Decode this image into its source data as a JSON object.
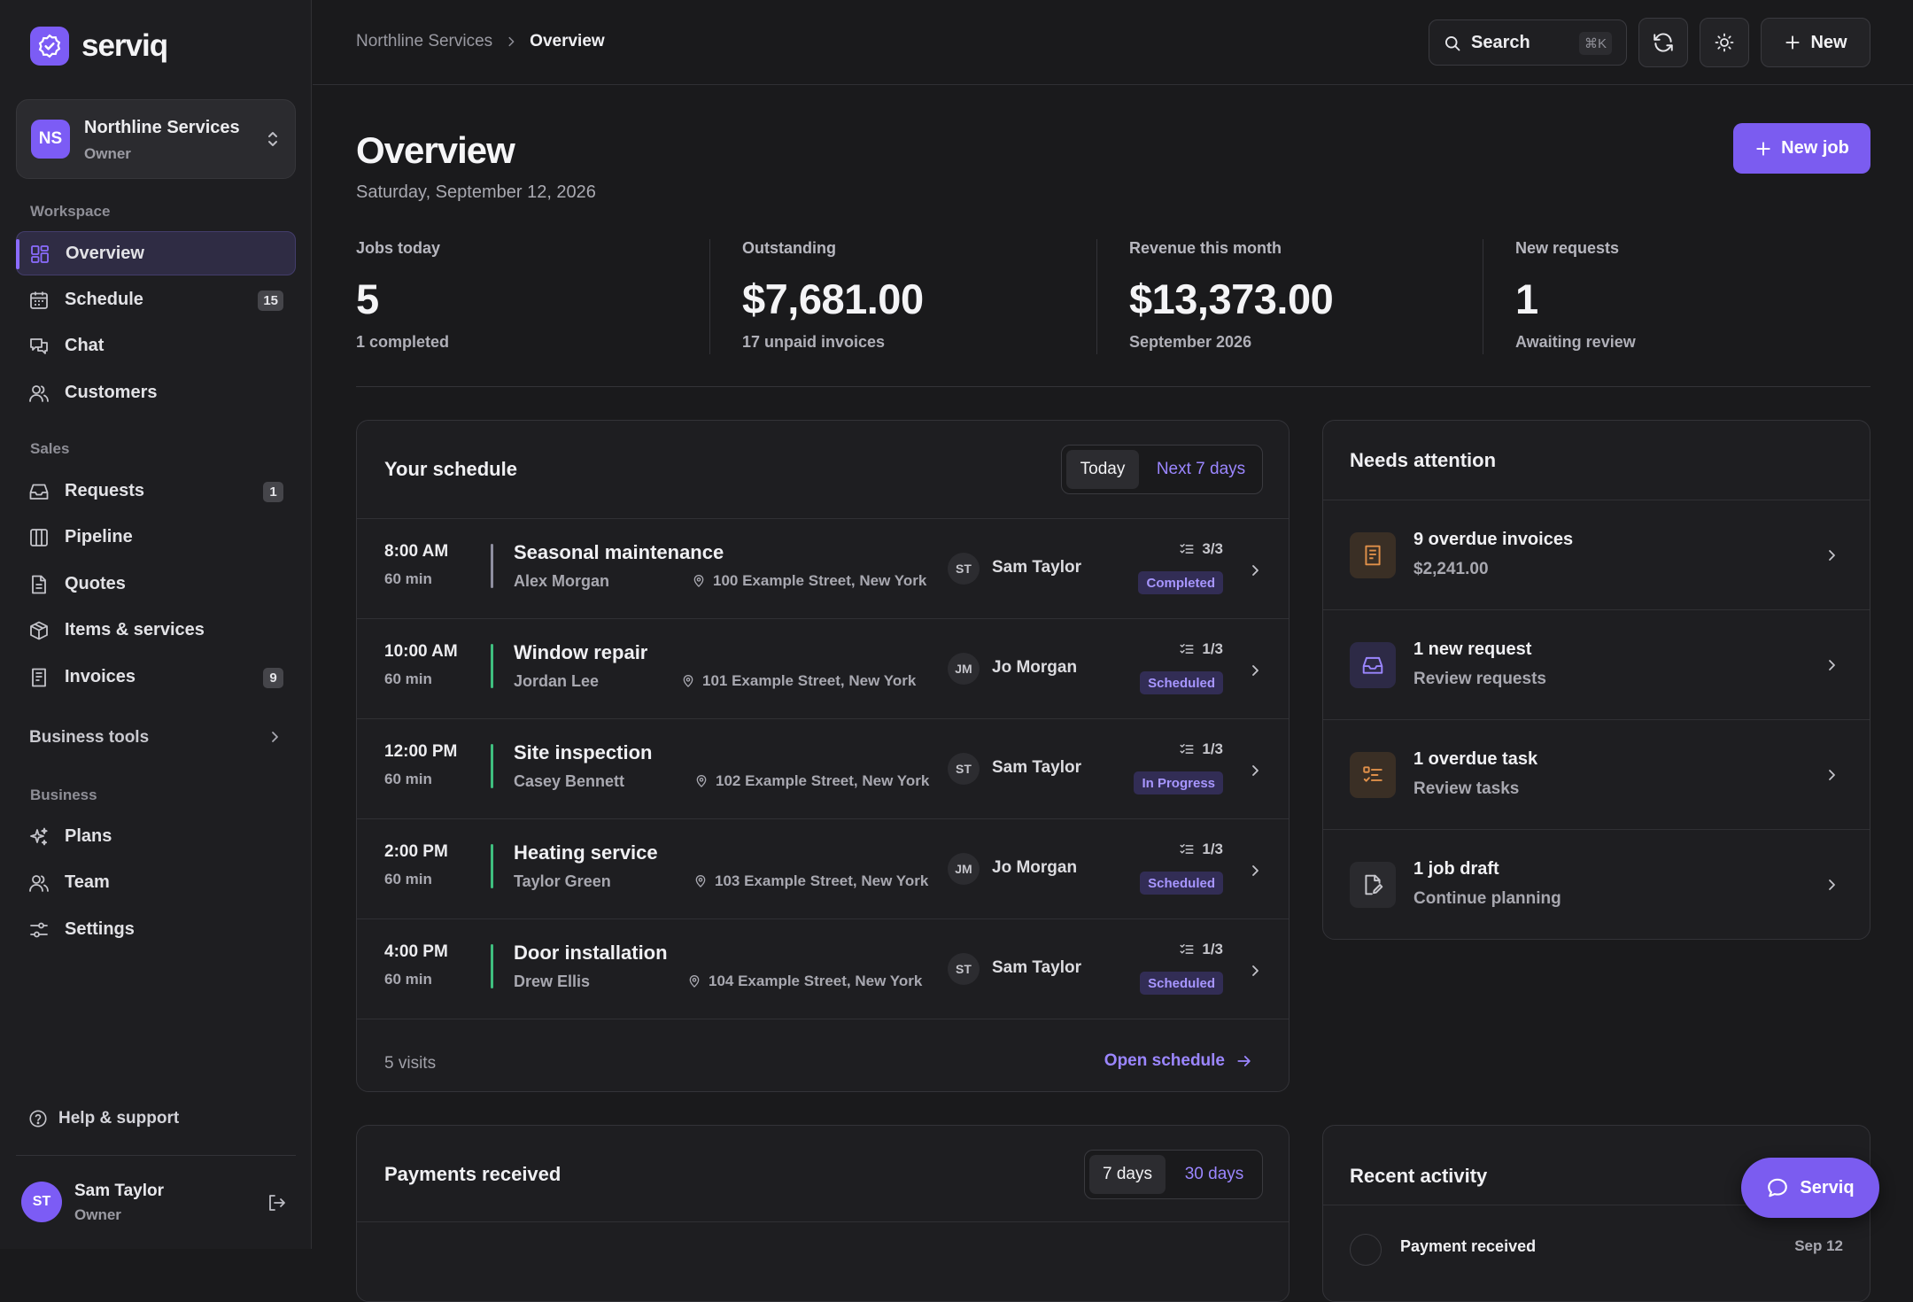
{
  "brand": {
    "name": "serviq"
  },
  "org": {
    "initials": "NS",
    "name": "Northline Services",
    "role": "Owner"
  },
  "sidebar": {
    "sections": {
      "workspace": "Workspace",
      "sales": "Sales",
      "business": "Business"
    },
    "workspace": [
      {
        "label": "Overview",
        "icon": "grid-icon",
        "active": true
      },
      {
        "label": "Schedule",
        "icon": "calendar-icon",
        "badge": "15"
      },
      {
        "label": "Chat",
        "icon": "chat-icon"
      },
      {
        "label": "Customers",
        "icon": "users-icon"
      }
    ],
    "sales": [
      {
        "label": "Requests",
        "icon": "inbox-icon",
        "badge": "1"
      },
      {
        "label": "Pipeline",
        "icon": "columns-icon"
      },
      {
        "label": "Quotes",
        "icon": "document-icon"
      },
      {
        "label": "Items & services",
        "icon": "box-icon"
      },
      {
        "label": "Invoices",
        "icon": "invoice-icon",
        "badge": "9"
      }
    ],
    "business_tools": "Business tools",
    "business": [
      {
        "label": "Plans",
        "icon": "sparkle-icon"
      },
      {
        "label": "Team",
        "icon": "users-icon"
      },
      {
        "label": "Settings",
        "icon": "sliders-icon"
      }
    ],
    "help": "Help & support",
    "user": {
      "initials": "ST",
      "name": "Sam Taylor",
      "role": "Owner"
    }
  },
  "topbar": {
    "breadcrumb": [
      "Northline Services",
      "Overview"
    ],
    "search_label": "Search",
    "search_shortcut": "⌘K",
    "new_label": "New"
  },
  "page": {
    "title": "Overview",
    "date": "Saturday, September 12, 2026",
    "new_job_label": "New job"
  },
  "stats": [
    {
      "label": "Jobs today",
      "value": "5",
      "sub": "1 completed"
    },
    {
      "label": "Outstanding",
      "value": "$7,681.00",
      "sub": "17 unpaid invoices"
    },
    {
      "label": "Revenue this month",
      "value": "$13,373.00",
      "sub": "September 2026"
    },
    {
      "label": "New requests",
      "value": "1",
      "sub": "Awaiting review"
    }
  ],
  "schedule": {
    "title": "Your schedule",
    "tabs": [
      "Today",
      "Next 7 days"
    ],
    "rows": [
      {
        "time": "8:00 AM",
        "duration": "60 min",
        "job": "Seasonal maintenance",
        "customer": "Alex Morgan",
        "address": "100 Example Street, New York",
        "tech_initials": "ST",
        "tech": "Sam Taylor",
        "tasks": "3/3",
        "status": "Completed",
        "color": "#8f8fa0"
      },
      {
        "time": "10:00 AM",
        "duration": "60 min",
        "job": "Window repair",
        "customer": "Jordan Lee",
        "address": "101 Example Street, New York",
        "tech_initials": "JM",
        "tech": "Jo Morgan",
        "tasks": "1/3",
        "status": "Scheduled",
        "color": "#3fbf7f"
      },
      {
        "time": "12:00 PM",
        "duration": "60 min",
        "job": "Site inspection",
        "customer": "Casey Bennett",
        "address": "102 Example Street, New York",
        "tech_initials": "ST",
        "tech": "Sam Taylor",
        "tasks": "1/3",
        "status": "In Progress",
        "color": "#3fbf7f"
      },
      {
        "time": "2:00 PM",
        "duration": "60 min",
        "job": "Heating service",
        "customer": "Taylor Green",
        "address": "103 Example Street, New York",
        "tech_initials": "JM",
        "tech": "Jo Morgan",
        "tasks": "1/3",
        "status": "Scheduled",
        "color": "#3fbf7f"
      },
      {
        "time": "4:00 PM",
        "duration": "60 min",
        "job": "Door installation",
        "customer": "Drew Ellis",
        "address": "104 Example Street, New York",
        "tech_initials": "ST",
        "tech": "Sam Taylor",
        "tasks": "1/3",
        "status": "Scheduled",
        "color": "#3fbf7f"
      }
    ],
    "footer_count": "5 visits",
    "open_label": "Open schedule"
  },
  "attention": {
    "title": "Needs attention",
    "items": [
      {
        "title": "9 overdue invoices",
        "sub": "$2,241.00",
        "icon": "invoice-icon",
        "tone": "#e0904a",
        "bg": "#3a2f25"
      },
      {
        "title": "1 new request",
        "sub": "Review requests",
        "icon": "inbox-icon",
        "tone": "#9b86ff",
        "bg": "#2d2a46"
      },
      {
        "title": "1 overdue task",
        "sub": "Review tasks",
        "icon": "task-list-icon",
        "tone": "#e0904a",
        "bg": "#3a2f25"
      },
      {
        "title": "1 job draft",
        "sub": "Continue planning",
        "icon": "edit-document-icon",
        "tone": "#c8c8ce",
        "bg": "#2a2a2e"
      }
    ]
  },
  "payments": {
    "title": "Payments received",
    "tabs": [
      "7 days",
      "30 days"
    ]
  },
  "activity": {
    "title": "Recent activity",
    "first_item": "Payment received",
    "first_date": "Sep 12"
  },
  "fab": {
    "label": "Serviq"
  }
}
